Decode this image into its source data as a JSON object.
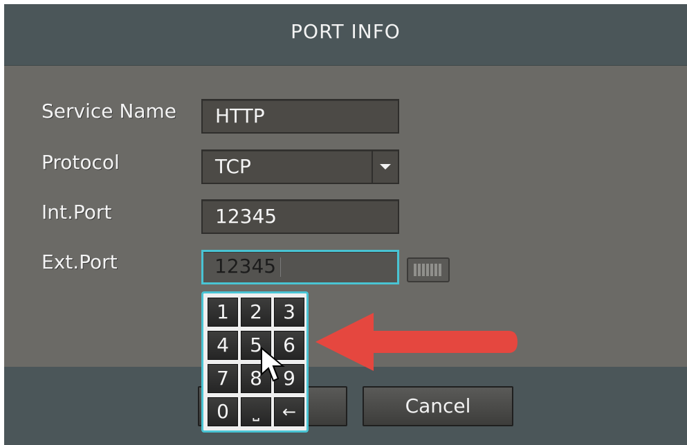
{
  "dialog": {
    "title": "PORT INFO"
  },
  "form": {
    "service_name": {
      "label": "Service Name",
      "value": "HTTP"
    },
    "protocol": {
      "label": "Protocol",
      "value": "TCP"
    },
    "int_port": {
      "label": "Int.Port",
      "value": "12345"
    },
    "ext_port": {
      "label": "Ext.Port",
      "value": "12345"
    }
  },
  "numpad": {
    "keys": [
      "1",
      "2",
      "3",
      "4",
      "5",
      "6",
      "7",
      "8",
      "9",
      "0",
      "⎵",
      "←"
    ]
  },
  "buttons": {
    "cancel": "Cancel"
  },
  "colors": {
    "focus": "#49c4d4",
    "annotation_arrow": "#e5473f"
  },
  "icons": {
    "keyboard": "keyboard-icon",
    "dropdown": "chevron-down-icon"
  }
}
